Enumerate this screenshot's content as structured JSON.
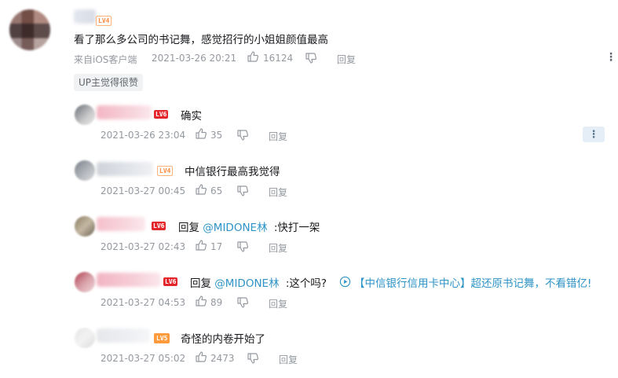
{
  "main_comment": {
    "level": "LV4",
    "text": "看了那么多公司的书记舞，感觉招行的小姐姐颜值最高",
    "source": "来自iOS客户端",
    "time": "2021-03-26 20:21",
    "likes": "16124",
    "reply_label": "回复",
    "up_tag": "UP主觉得很赞"
  },
  "replies": [
    {
      "level": "LV6",
      "text": "确实",
      "time": "2021-03-26 23:04",
      "likes": "35",
      "reply_label": "回复"
    },
    {
      "level": "LV4",
      "text": "中信银行最高我觉得",
      "time": "2021-03-27 00:45",
      "likes": "65",
      "reply_label": "回复"
    },
    {
      "level": "LV6",
      "prefix": "回复",
      "mention": "@MIDONE林",
      "text": ":快打一架",
      "time": "2021-03-27 02:43",
      "likes": "17",
      "reply_label": "回复"
    },
    {
      "level": "LV6",
      "prefix": "回复",
      "mention": "@MIDONE林",
      "text": ":这个吗?",
      "video_link": "【中信银行信用卡中心】超还原书记舞，不看错亿!",
      "time": "2021-03-27 04:53",
      "likes": "89",
      "reply_label": "回复"
    },
    {
      "level": "LV5",
      "text": "奇怪的内卷开始了",
      "time": "2021-03-27 05:02",
      "likes": "2473",
      "reply_label": "回复"
    }
  ],
  "icons": {
    "like": "thumbs-up-icon",
    "dislike": "thumbs-down-icon",
    "more": "more-vertical-icon",
    "play": "play-circle-icon"
  },
  "colors": {
    "link": "#2e93c7",
    "meta": "#9499a0",
    "level_red": "#e3262b",
    "level_orange": "#ff8a3d"
  }
}
